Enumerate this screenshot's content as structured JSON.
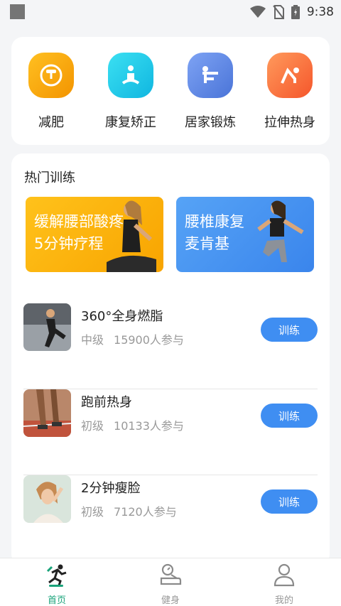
{
  "status_bar": {
    "time": "9:38",
    "icons": [
      "wifi-icon",
      "no-sim-icon",
      "battery-icon"
    ]
  },
  "categories": [
    {
      "label": "减肥",
      "icon": "scale-icon",
      "color": "#f5a10c"
    },
    {
      "label": "康复矫正",
      "icon": "meditation-icon",
      "color": "#17c7e6"
    },
    {
      "label": "居家锻炼",
      "icon": "exercise-icon",
      "color": "#5a86e8"
    },
    {
      "label": "拉伸热身",
      "icon": "stretch-icon",
      "color": "#fb6f3c"
    }
  ],
  "hot": {
    "title": "热门训练",
    "banners": [
      {
        "line1": "缓解腰部酸疼",
        "line2": "5分钟疗程",
        "color": "#fbb417"
      },
      {
        "line1": "腰椎康复",
        "line2": "麦肯基",
        "color": "#4a97f1"
      }
    ],
    "items": [
      {
        "title": "360°全身燃脂",
        "level": "中级",
        "participants": "15900人参与",
        "button": "训练"
      },
      {
        "title": "跑前热身",
        "level": "初级",
        "participants": "10133人参与",
        "button": "训练"
      },
      {
        "title": "2分钟瘦脸",
        "level": "初级",
        "participants": "7120人参与",
        "button": "训练"
      }
    ]
  },
  "tabbar": {
    "tabs": [
      {
        "label": "首页",
        "icon": "runner-icon",
        "active": true
      },
      {
        "label": "健身",
        "icon": "scale-icon",
        "active": false
      },
      {
        "label": "我的",
        "icon": "user-icon",
        "active": false
      }
    ]
  }
}
